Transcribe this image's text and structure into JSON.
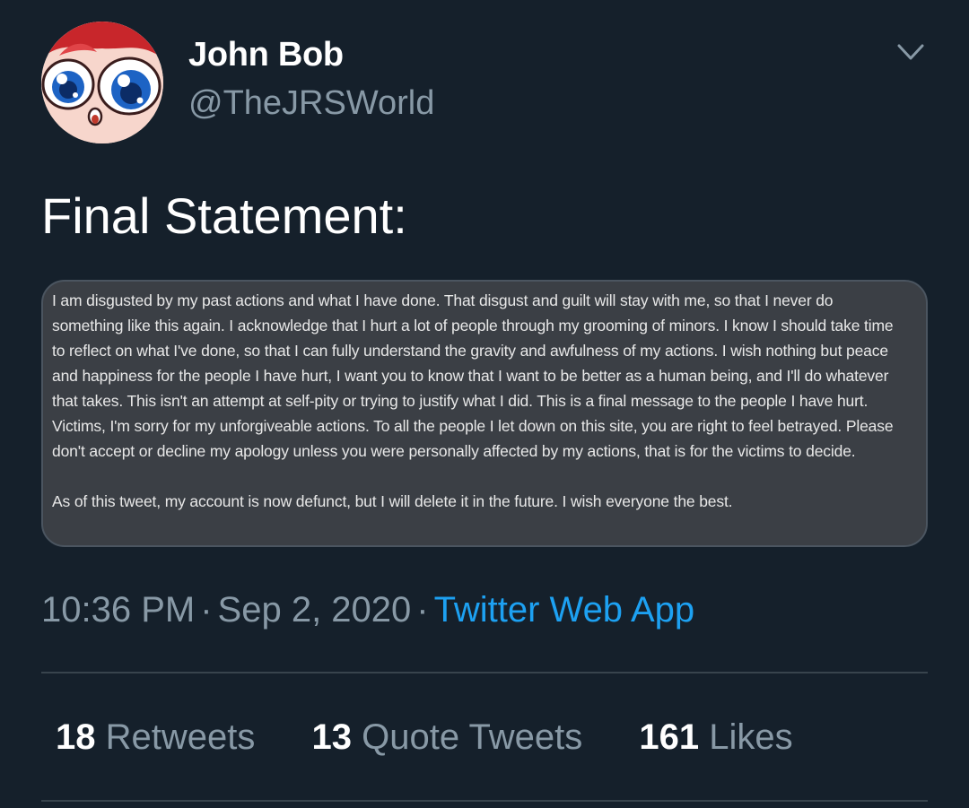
{
  "header": {
    "display_name": "John Bob",
    "handle": "@TheJRSWorld",
    "avatar_icon": "cartoon-face-avatar",
    "more_icon": "chevron-down-icon"
  },
  "tweet": {
    "text": "Final Statement:",
    "image_text": {
      "paragraph_1": "I am disgusted by my past actions and what I have done. That disgust and guilt will stay with me, so that I never do something like this again. I acknowledge that I hurt a lot of people through my grooming of minors. I know I should take time to reflect on what I've done, so that I can fully understand the gravity and awfulness of my actions. I wish nothing but peace and happiness for the people I have hurt, I want you to know that I want to be better as a human being, and I'll do whatever that takes. This isn't an attempt at self-pity or trying to justify what I did. This is a final message to the people I have hurt. Victims, I'm sorry for my unforgiveable actions. To all the people I let down on this site, you are right to feel betrayed. Please don't accept or decline my apology unless you were personally affected by my actions, that is for the victims to decide.",
      "paragraph_2": "As of this tweet, my account is now defunct, but I will delete it in the future. I wish everyone the best."
    }
  },
  "meta": {
    "time": "10:36 PM",
    "separator": "·",
    "date": "Sep 2, 2020",
    "source": "Twitter Web App"
  },
  "stats": {
    "retweets": {
      "count": "18",
      "label": "Retweets"
    },
    "quote_tweets": {
      "count": "13",
      "label": "Quote Tweets"
    },
    "likes": {
      "count": "161",
      "label": "Likes"
    }
  },
  "colors": {
    "background": "#15202b",
    "secondary_text": "#8899a6",
    "accent": "#1da1f2",
    "divider": "#38444d",
    "card_background": "#3b3f45"
  }
}
